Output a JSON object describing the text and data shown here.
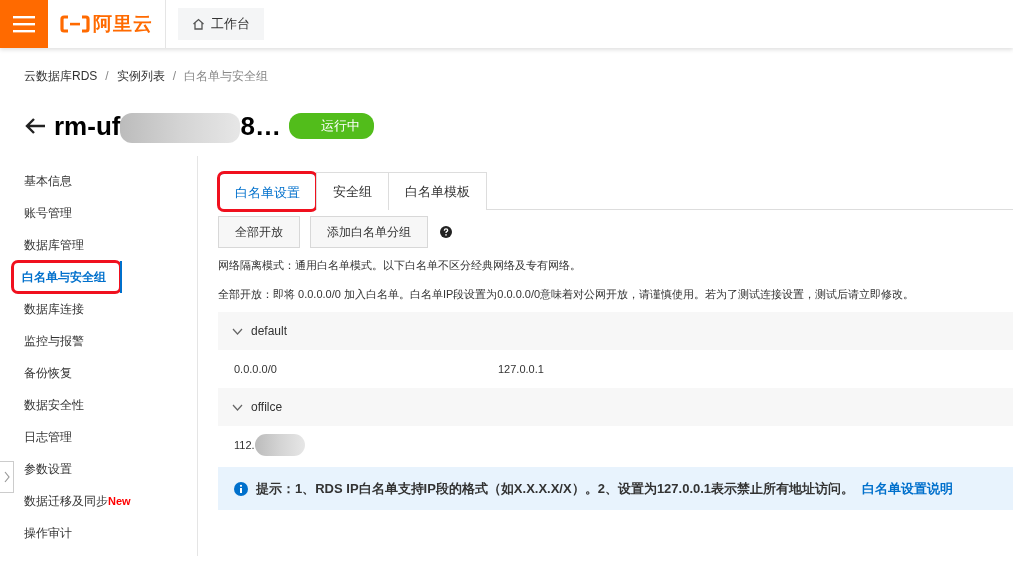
{
  "header": {
    "logo_text": "阿里云",
    "workbench": "工作台"
  },
  "breadcrumb": [
    {
      "label": "云数据库RDS",
      "current": false,
      "separator": "/"
    },
    {
      "label": "实例列表",
      "current": false,
      "separator": "/"
    },
    {
      "label": "白名单与安全组",
      "current": true
    }
  ],
  "instance": {
    "title_start": "rm-uf",
    "title_end": "8…",
    "status": "运行中"
  },
  "sidebar": {
    "items": [
      {
        "label": "基本信息",
        "selected": false,
        "highlighted": false
      },
      {
        "label": "账号管理",
        "selected": false,
        "highlighted": false
      },
      {
        "label": "数据库管理",
        "selected": false,
        "highlighted": false
      },
      {
        "label": "白名单与安全组",
        "selected": true,
        "highlighted": true
      },
      {
        "label": "数据库连接",
        "selected": false,
        "highlighted": false
      },
      {
        "label": "监控与报警",
        "selected": false,
        "highlighted": false
      },
      {
        "label": "备份恢复",
        "selected": false,
        "highlighted": false
      },
      {
        "label": "数据安全性",
        "selected": false,
        "highlighted": false
      },
      {
        "label": "日志管理",
        "selected": false,
        "highlighted": false
      },
      {
        "label": "参数设置",
        "selected": false,
        "highlighted": false
      },
      {
        "label": "数据迁移及同步",
        "selected": false,
        "highlighted": false,
        "badge": "New"
      },
      {
        "label": "操作审计",
        "selected": false,
        "highlighted": false
      }
    ]
  },
  "tabs": [
    {
      "label": "白名单设置",
      "selected": true,
      "highlighted": true
    },
    {
      "label": "安全组",
      "selected": false,
      "highlighted": false
    },
    {
      "label": "白名单模板",
      "selected": false,
      "highlighted": false
    }
  ],
  "buttons": [
    "全部开放",
    "添加白名单分组"
  ],
  "notes": [
    "网络隔离模式：通用白名单模式。以下白名单不区分经典网络及专有网络。",
    "全部开放：即将 0.0.0.0/0 加入白名单。白名单IP段设置为0.0.0.0/0意味着对公网开放，请谨慎使用。若为了测试连接设置，测试后请立即修改。"
  ],
  "groups": [
    {
      "name": "default",
      "expanded": true,
      "ips": [
        "0.0.0.0/0",
        "127.0.0.1"
      ],
      "redacted": false
    },
    {
      "name": "offilce",
      "expanded": true,
      "ips": [
        "112."
      ],
      "redacted": true
    }
  ],
  "tip": {
    "text": "提示：1、RDS IP白名单支持IP段的格式（如X.X.X.X/X）。2、设置为127.0.0.1表示禁止所有地址访问。",
    "link": "白名单设置说明"
  }
}
